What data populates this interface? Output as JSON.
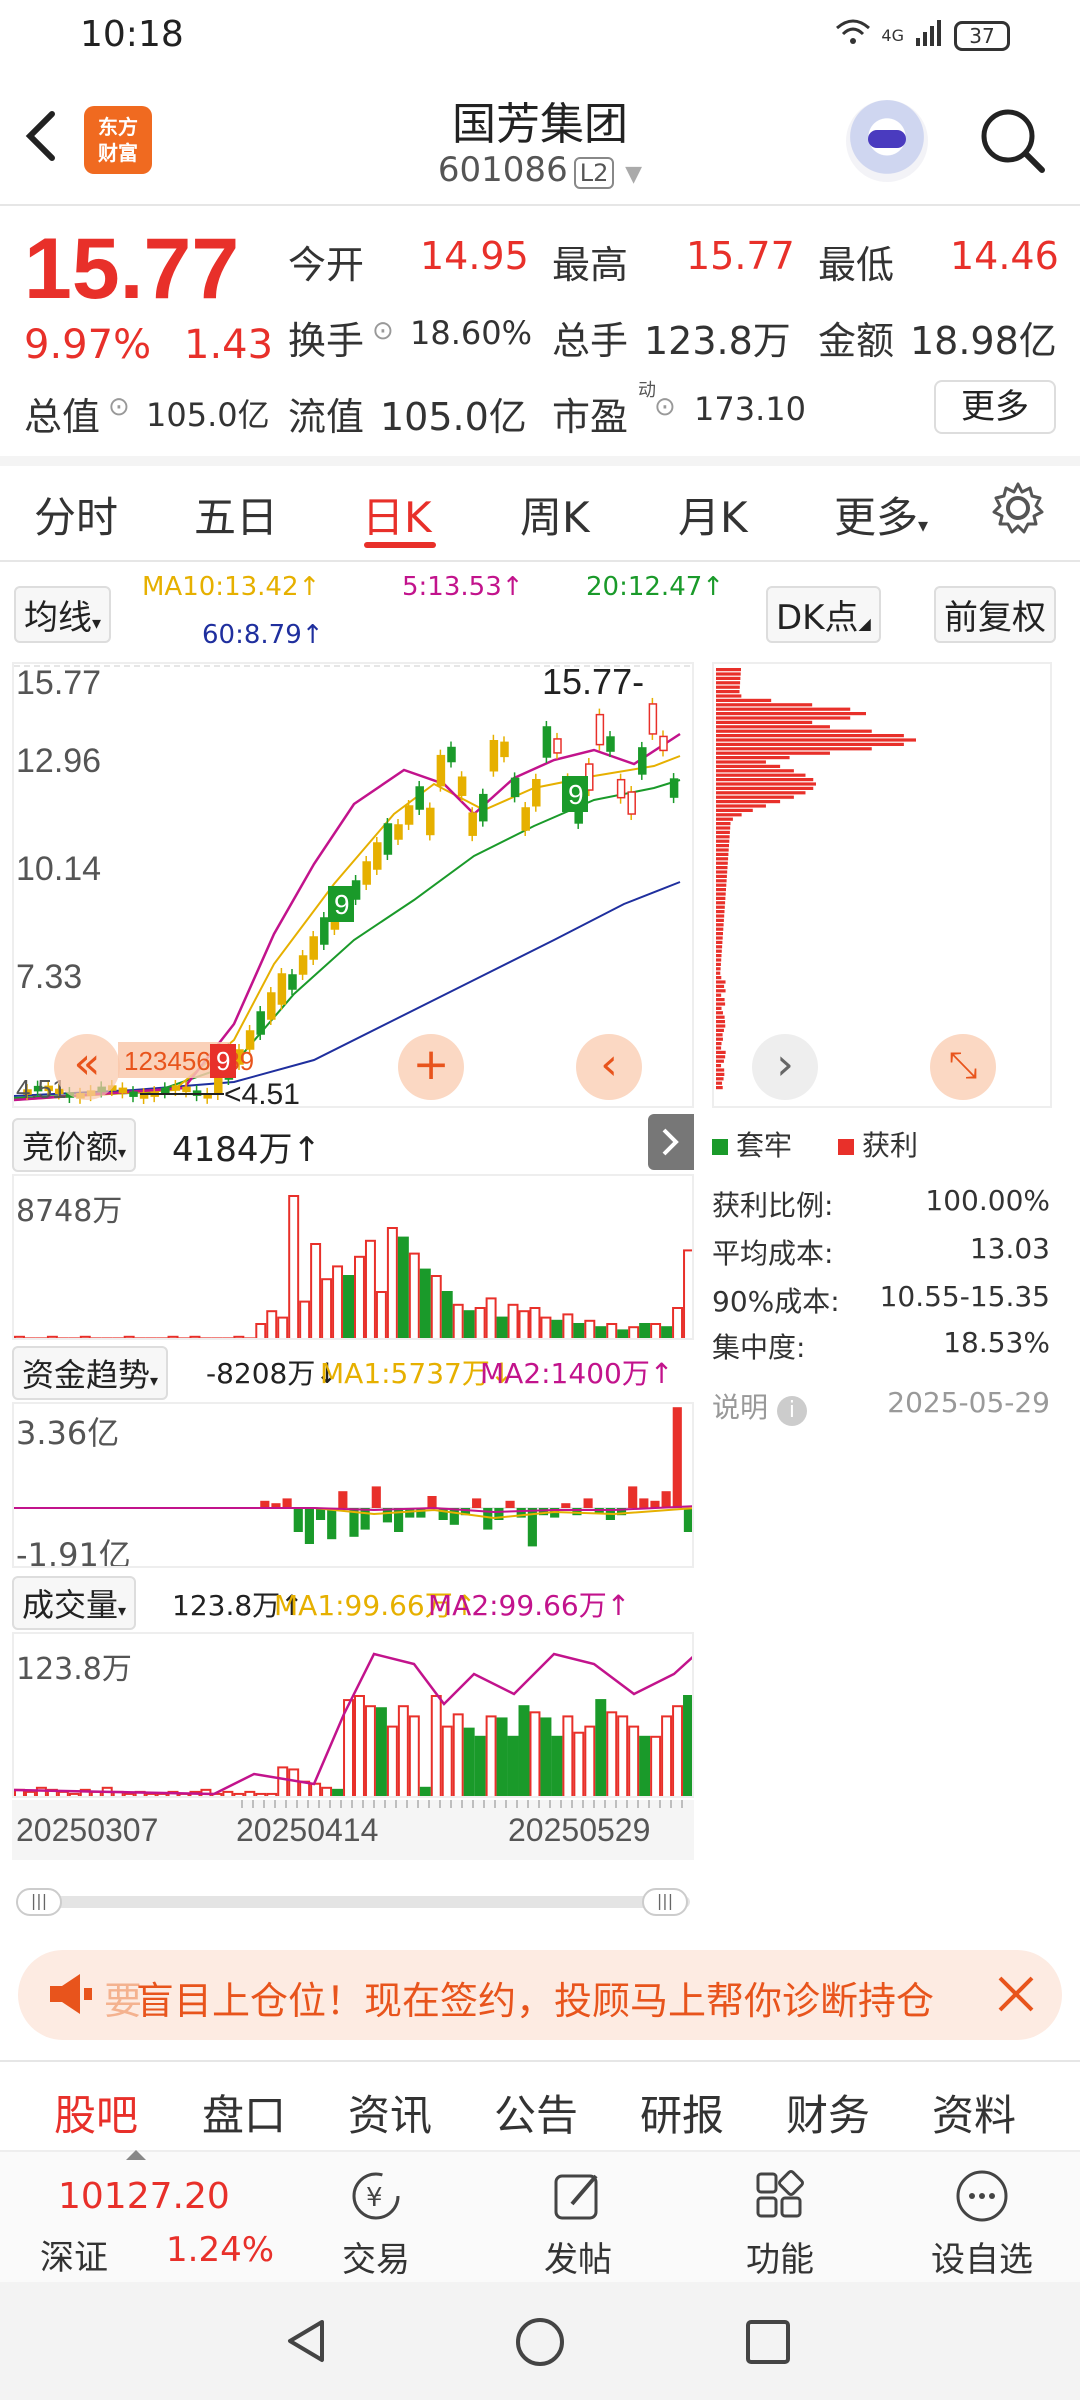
{
  "status_bar": {
    "time": "10:18",
    "network": "4G",
    "battery": "37"
  },
  "header": {
    "logo_line1": "东方",
    "logo_line2": "财富",
    "stock_name": "国芳集团",
    "stock_code": "601086",
    "level_badge": "L2"
  },
  "quote": {
    "price": "15.77",
    "change_pct": "9.97%",
    "change": "1.43",
    "open_label": "今开",
    "open": "14.95",
    "high_label": "最高",
    "high": "15.77",
    "low_label": "最低",
    "low": "14.46",
    "turnover_label": "换手",
    "turnover": "18.60%",
    "volume_label": "总手",
    "volume": "123.8万",
    "amount_label": "金额",
    "amount": "18.98亿",
    "mktcap_label": "总值",
    "mktcap": "105.0亿",
    "float_label": "流值",
    "float_cap": "105.0亿",
    "pe_label": "市盈",
    "pe_sup": "动",
    "pe": "173.10",
    "more_label": "更多"
  },
  "period_tabs": [
    "分时",
    "五日",
    "日K",
    "周K",
    "月K",
    "更多"
  ],
  "indicator_row": {
    "ma_select": "均线",
    "ma10": "MA10:13.42↑",
    "ma5": "5:13.53↑",
    "ma20": "20:12.47↑",
    "ma60": "60:8.79↑",
    "dk_select": "DK点",
    "adjust_select": "前复权"
  },
  "kline": {
    "y_labels": [
      "15.77",
      "12.96",
      "10.14",
      "7.33",
      "4.51"
    ],
    "last_price_tag": "15.77",
    "low_marker": "4.51",
    "td_seq_low": "123456789",
    "overlay_buttons": [
      "«",
      "+",
      "‹",
      "›",
      "⤡"
    ]
  },
  "chips": {
    "legend_locked": "套牢",
    "legend_profit": "获利",
    "profit_ratio_label": "获利比例:",
    "profit_ratio": "100.00%",
    "avg_cost_label": "平均成本:",
    "avg_cost": "13.03",
    "cost90_label": "90%成本:",
    "cost90": "10.55-15.35",
    "concentration_label": "集中度:",
    "concentration": "18.53%",
    "note_label": "说明",
    "date": "2025-05-29"
  },
  "auction": {
    "select": "竞价额",
    "value": "4184万↑",
    "max_label": "8748万"
  },
  "fund_trend": {
    "select": "资金趋势",
    "value": "-8208万↓",
    "ma1": "MA1:5737万↓",
    "ma2": "MA2:1400万↑",
    "top_label": "3.36亿",
    "bottom_label": "-1.91亿"
  },
  "volume": {
    "select": "成交量",
    "value": "123.8万↑",
    "ma1": "MA1:99.66万↑",
    "ma2": "MA2:99.66万↑",
    "max_label": "123.8万",
    "dates": [
      "20250307",
      "20250414",
      "20250529"
    ]
  },
  "banner": {
    "text": "盲目上仓位！现在签约，投顾马上帮你诊断持仓",
    "lead_char": "要"
  },
  "bottom_tabs": [
    "股吧",
    "盘口",
    "资讯",
    "公告",
    "研报",
    "财务",
    "资料"
  ],
  "footer": {
    "index_value": "10127.20",
    "index_name": "深证",
    "index_pct": "1.24%",
    "items": [
      "交易",
      "发帖",
      "功能",
      "设自选"
    ]
  },
  "colors": {
    "up": "#e8302a",
    "down": "#1a9a2a",
    "accent": "#f06a20",
    "ma5": "#c2138c",
    "ma10": "#e6b000",
    "ma20": "#1a9a2a",
    "ma60": "#1f2f9e"
  }
}
